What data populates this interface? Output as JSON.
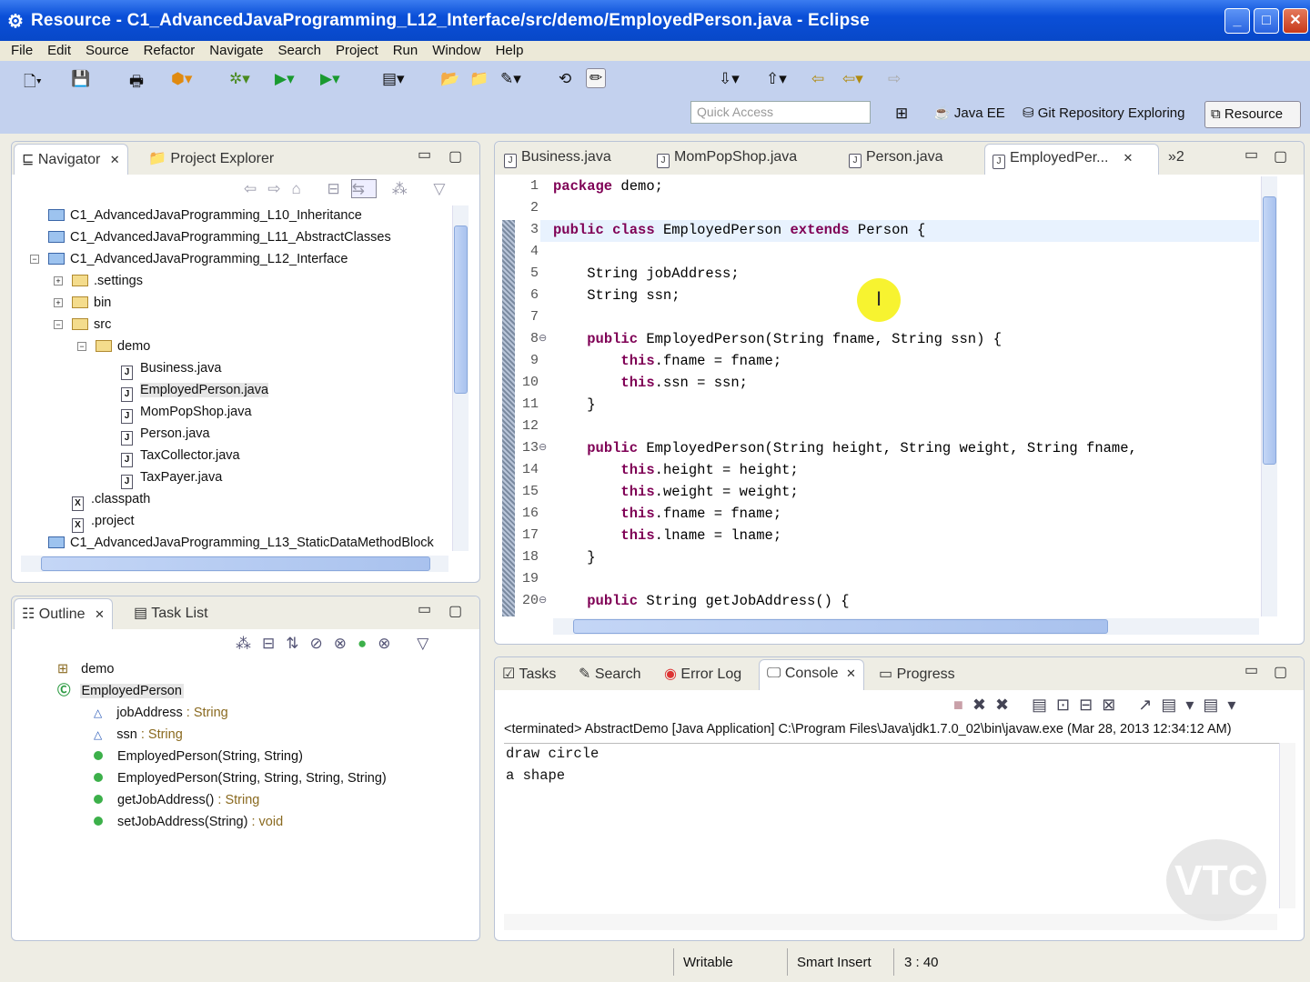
{
  "window": {
    "title": "Resource - C1_AdvancedJavaProgramming_L12_Interface/src/demo/EmployedPerson.java - Eclipse"
  },
  "menu": [
    "File",
    "Edit",
    "Source",
    "Refactor",
    "Navigate",
    "Search",
    "Project",
    "Run",
    "Window",
    "Help"
  ],
  "toolbar": {
    "quick_access_placeholder": "Quick Access",
    "perspectives": [
      "Java EE",
      "Git Repository Exploring",
      "Resource"
    ]
  },
  "navigator": {
    "tabs": [
      "Navigator",
      "Project Explorer"
    ],
    "tree": [
      {
        "label": "C1_AdvancedJavaProgramming_L10_Inheritance",
        "type": "project"
      },
      {
        "label": "C1_AdvancedJavaProgramming_L11_AbstractClasses",
        "type": "project"
      },
      {
        "label": "C1_AdvancedJavaProgramming_L12_Interface",
        "type": "project-open"
      },
      {
        "label": ".settings",
        "type": "folder"
      },
      {
        "label": "bin",
        "type": "folder"
      },
      {
        "label": "src",
        "type": "folder"
      },
      {
        "label": "demo",
        "type": "folder"
      },
      {
        "label": "Business.java",
        "type": "java"
      },
      {
        "label": "EmployedPerson.java",
        "type": "java",
        "selected": true
      },
      {
        "label": "MomPopShop.java",
        "type": "java"
      },
      {
        "label": "Person.java",
        "type": "java"
      },
      {
        "label": "TaxCollector.java",
        "type": "java"
      },
      {
        "label": "TaxPayer.java",
        "type": "java"
      },
      {
        "label": ".classpath",
        "type": "xml"
      },
      {
        "label": ".project",
        "type": "xml"
      },
      {
        "label": "C1_AdvancedJavaProgramming_L13_StaticDataMethodBlock",
        "type": "project"
      }
    ]
  },
  "outline": {
    "tabs": [
      "Outline",
      "Task List"
    ],
    "package": "demo",
    "class": "EmployedPerson",
    "members": [
      {
        "name": "jobAddress",
        "type": " : String",
        "kind": "field"
      },
      {
        "name": "ssn",
        "type": " : String",
        "kind": "field"
      },
      {
        "name": "EmployedPerson(String, String)",
        "type": "",
        "kind": "ctor"
      },
      {
        "name": "EmployedPerson(String, String, String, String)",
        "type": "",
        "kind": "ctor"
      },
      {
        "name": "getJobAddress()",
        "type": " : String",
        "kind": "method"
      },
      {
        "name": "setJobAddress(String)",
        "type": " : void",
        "kind": "method"
      }
    ]
  },
  "editor": {
    "tabs": [
      "Business.java",
      "MomPopShop.java",
      "Person.java",
      "EmployedPer...",
      "»2"
    ],
    "lines": [
      "package demo;",
      "",
      "public class EmployedPerson extends Person {",
      "",
      "    String jobAddress;",
      "    String ssn;",
      "",
      "    public EmployedPerson(String fname, String ssn) {",
      "        this.fname = fname;",
      "        this.ssn = ssn;",
      "    }",
      "",
      "    public EmployedPerson(String height, String weight, String fname,",
      "        this.height = height;",
      "        this.weight = weight;",
      "        this.fname = fname;",
      "        this.lname = lname;",
      "    }",
      "",
      "    public String getJobAddress() {"
    ]
  },
  "console": {
    "tabs": [
      "Tasks",
      "Search",
      "Error Log",
      "Console",
      "Progress"
    ],
    "header": "<terminated> AbstractDemo [Java Application] C:\\Program Files\\Java\\jdk1.7.0_02\\bin\\javaw.exe (Mar 28, 2013 12:34:12 AM)",
    "output": [
      "draw circle",
      "a shape"
    ],
    "watermark": "VTC"
  },
  "status": {
    "writable": "Writable",
    "insert": "Smart Insert",
    "position": "3 : 40"
  }
}
